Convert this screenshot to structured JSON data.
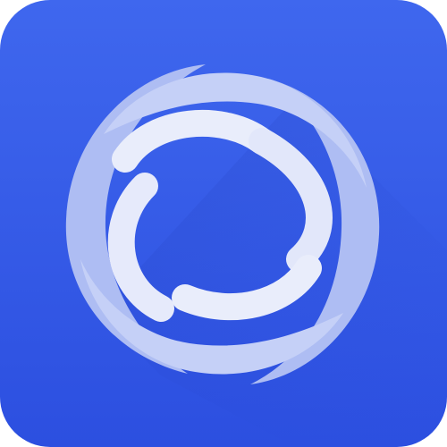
{
  "icon": {
    "name": "swirl-app-icon",
    "colors": {
      "background_top": "#3f67ee",
      "background_bottom": "#2c4fe0",
      "shadow": "#233fb9",
      "ring_light": "#e7ebfb",
      "ring_mid": "#c5d0f7",
      "ring_dark": "#9fb1f0"
    }
  }
}
